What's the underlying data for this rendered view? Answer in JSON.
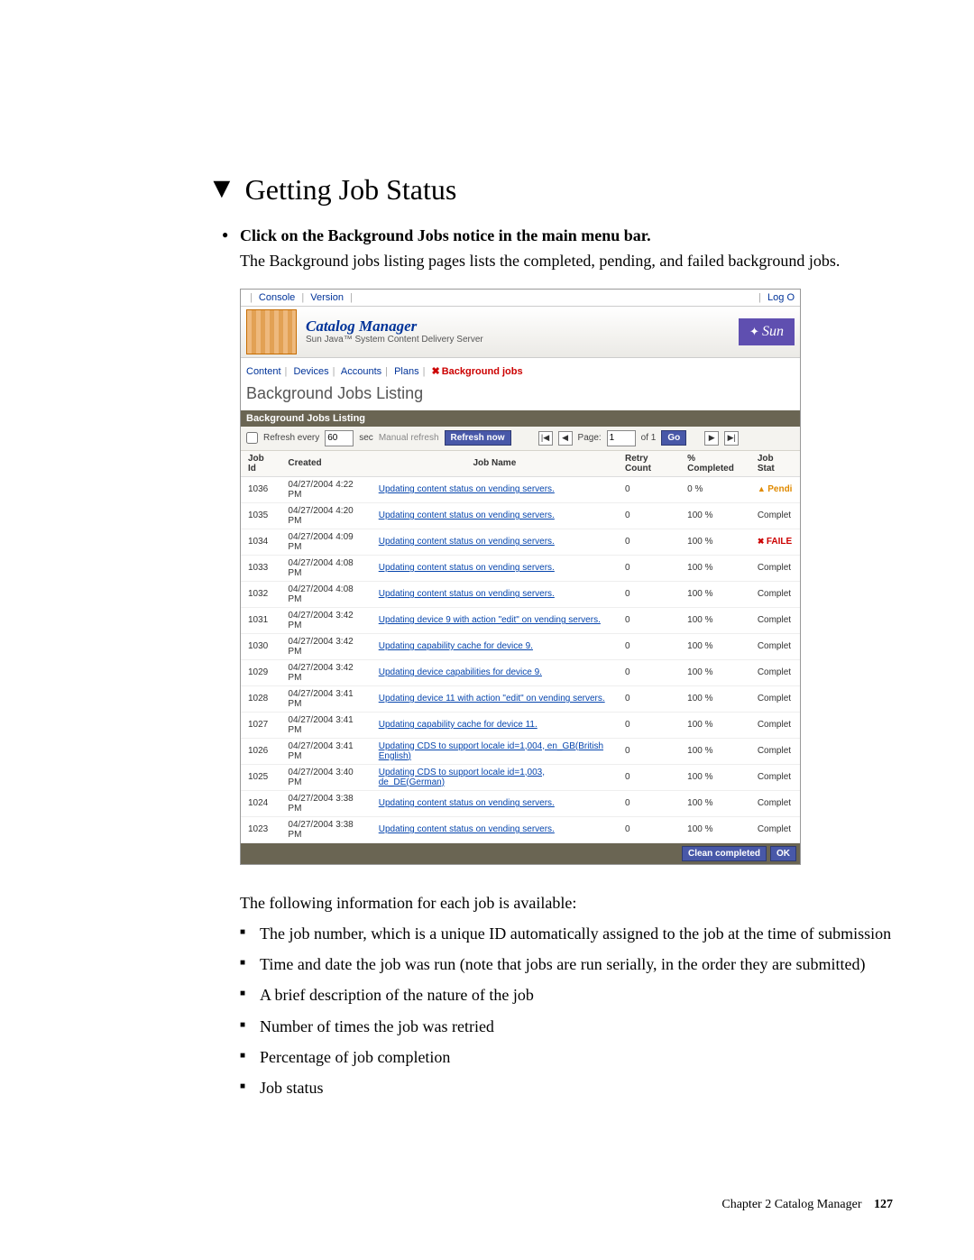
{
  "heading": "Getting Job Status",
  "step_title": "Click on the Background Jobs notice in the main menu bar.",
  "step_desc": "The Background jobs listing pages lists the completed, pending, and failed background jobs.",
  "intro_after": "The following information for each job is available:",
  "info_items": [
    "The job number, which is a unique ID automatically assigned to the job at the time of submission",
    "Time and date the job was run (note that jobs are run serially, in the order they are submitted)",
    "A brief description of the nature of the job",
    "Number of times the job was retried",
    "Percentage of job completion",
    "Job status"
  ],
  "footer_chapter": "Chapter 2   Catalog Manager",
  "footer_page": "127",
  "ui": {
    "top_left": {
      "console": "Console",
      "version": "Version"
    },
    "top_right": {
      "logout": "Log O"
    },
    "app_title": "Catalog Manager",
    "app_sub": "Sun Java™ System Content Delivery Server",
    "sun": "Sun",
    "tabs": {
      "content": "Content",
      "devices": "Devices",
      "accounts": "Accounts",
      "plans": "Plans",
      "bg": "Background jobs"
    },
    "page_title": "Background Jobs Listing",
    "panel_title": "Background Jobs Listing",
    "toolbar": {
      "refresh_label": "Refresh every",
      "refresh_value": "60",
      "sec": "sec",
      "manual": "Manual refresh",
      "refresh_now": "Refresh now",
      "page_label": "Page:",
      "page_value": "1",
      "of_label": "of 1",
      "go": "Go"
    },
    "columns": {
      "jobid": "Job Id",
      "created": "Created",
      "jobname": "Job Name",
      "retry": "Retry Count",
      "pct": "% Completed",
      "state": "Job Stat"
    },
    "rows": [
      {
        "id": "1036",
        "created": "04/27/2004 4:22 PM",
        "name": "Updating content status on vending servers.",
        "retry": "0",
        "pct": "0 %",
        "state": "Pendi",
        "state_cls": "st-pending"
      },
      {
        "id": "1035",
        "created": "04/27/2004 4:20 PM",
        "name": "Updating content status on vending servers.",
        "retry": "0",
        "pct": "100 %",
        "state": "Complet",
        "state_cls": ""
      },
      {
        "id": "1034",
        "created": "04/27/2004 4:09 PM",
        "name": "Updating content status on vending servers.",
        "retry": "0",
        "pct": "100 %",
        "state": "FAILE",
        "state_cls": "st-failed"
      },
      {
        "id": "1033",
        "created": "04/27/2004 4:08 PM",
        "name": "Updating content status on vending servers.",
        "retry": "0",
        "pct": "100 %",
        "state": "Complet",
        "state_cls": ""
      },
      {
        "id": "1032",
        "created": "04/27/2004 4:08 PM",
        "name": "Updating content status on vending servers.",
        "retry": "0",
        "pct": "100 %",
        "state": "Complet",
        "state_cls": ""
      },
      {
        "id": "1031",
        "created": "04/27/2004 3:42 PM",
        "name": "Updating device 9 with action \"edit\" on vending servers.",
        "retry": "0",
        "pct": "100 %",
        "state": "Complet",
        "state_cls": ""
      },
      {
        "id": "1030",
        "created": "04/27/2004 3:42 PM",
        "name": "Updating capability cache for device 9.",
        "retry": "0",
        "pct": "100 %",
        "state": "Complet",
        "state_cls": ""
      },
      {
        "id": "1029",
        "created": "04/27/2004 3:42 PM",
        "name": "Updating device capabilities for device 9.",
        "retry": "0",
        "pct": "100 %",
        "state": "Complet",
        "state_cls": ""
      },
      {
        "id": "1028",
        "created": "04/27/2004 3:41 PM",
        "name": "Updating device 11 with action \"edit\" on vending servers.",
        "retry": "0",
        "pct": "100 %",
        "state": "Complet",
        "state_cls": ""
      },
      {
        "id": "1027",
        "created": "04/27/2004 3:41 PM",
        "name": "Updating capability cache for device 11.",
        "retry": "0",
        "pct": "100 %",
        "state": "Complet",
        "state_cls": ""
      },
      {
        "id": "1026",
        "created": "04/27/2004 3:41 PM",
        "name": "Updating CDS to support locale id=1,004, en_GB(British English)",
        "retry": "0",
        "pct": "100 %",
        "state": "Complet",
        "state_cls": ""
      },
      {
        "id": "1025",
        "created": "04/27/2004 3:40 PM",
        "name": "Updating CDS to support locale id=1,003, de_DE(German)",
        "retry": "0",
        "pct": "100 %",
        "state": "Complet",
        "state_cls": ""
      },
      {
        "id": "1024",
        "created": "04/27/2004 3:38 PM",
        "name": "Updating content status on vending servers.",
        "retry": "0",
        "pct": "100 %",
        "state": "Complet",
        "state_cls": ""
      },
      {
        "id": "1023",
        "created": "04/27/2004 3:38 PM",
        "name": "Updating content status on vending servers.",
        "retry": "0",
        "pct": "100 %",
        "state": "Complet",
        "state_cls": ""
      }
    ],
    "foot": {
      "clean": "Clean completed",
      "ok": "OK"
    }
  }
}
